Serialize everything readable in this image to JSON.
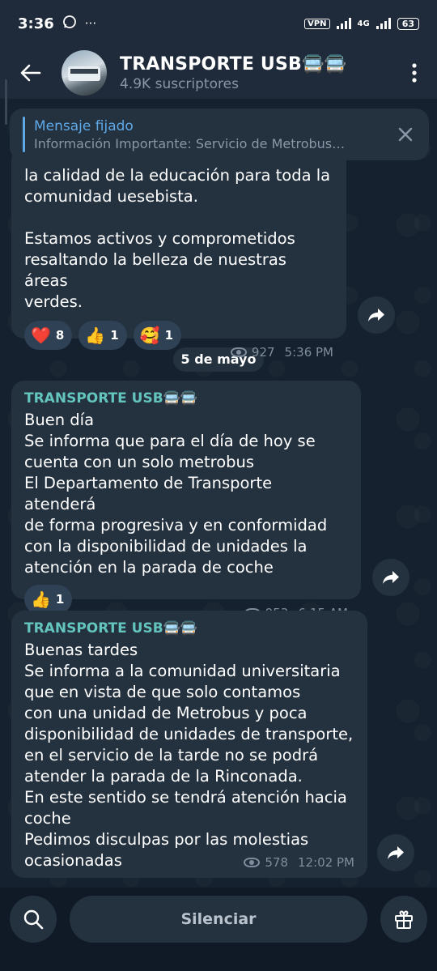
{
  "status_bar": {
    "time": "3:36",
    "whatsapp_icon": "whatsapp-icon",
    "more": "···",
    "vpn": "VPN",
    "network": "4G",
    "battery": "63"
  },
  "header": {
    "title": "TRANSPORTE USB🚍🚍",
    "subtitle": "4.9K suscriptores"
  },
  "pinned": {
    "title": "Mensaje fijado",
    "body": "Información Importante:   Servicio de Metrobus…"
  },
  "messages": [
    {
      "author": "",
      "text": "la calidad de la educación para toda la\ncomunidad uesebista.\n\nEstamos activos y comprometidos\nresaltando la belleza de nuestras áreas\nverdes.",
      "reactions": [
        {
          "emoji": "❤️",
          "count": "8"
        },
        {
          "emoji": "👍",
          "count": "1"
        },
        {
          "emoji": "🥰",
          "count": "1"
        }
      ],
      "views": "927",
      "time": "5:36 PM"
    },
    {
      "author": "TRANSPORTE USB🚍🚍",
      "text": "Buen día\nSe informa que para el día de hoy se\ncuenta con un solo metrobus\nEl Departamento de Transporte atenderá\nde forma progresiva y en conformidad\ncon la disponibilidad de unidades la\natención en la parada de coche",
      "reactions": [
        {
          "emoji": "👍",
          "count": "1"
        }
      ],
      "views": "953",
      "time": "6:15 AM"
    },
    {
      "author": "TRANSPORTE USB🚍🚍",
      "text": "Buenas tardes\nSe informa a la comunidad universitaria\nque en vista de que solo contamos\ncon una unidad de Metrobus y poca\ndisponibilidad de unidades de transporte,\nen el servicio de la tarde no se podrá\natender la parada de la Rinconada.\nEn este sentido se tendrá atención hacia\ncoche\nPedimos disculpas por las molestias\nocasionadas",
      "views": "578",
      "time": "12:02 PM"
    }
  ],
  "date_separator": "5 de mayo",
  "bottom": {
    "mute_label": "Silenciar"
  },
  "colors": {
    "header_bg": "#1f2b3a",
    "bubble_bg": "#24313f",
    "author": "#63c5bd",
    "link": "#5ea8e6"
  }
}
